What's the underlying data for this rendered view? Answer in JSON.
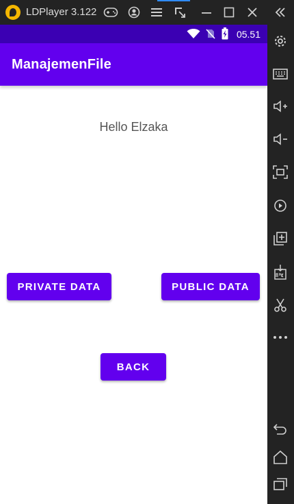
{
  "emulator": {
    "title": "LDPlayer 3.122",
    "titlebar_icons": [
      "gamepad-icon",
      "account-icon",
      "menu-icon",
      "sync-icon",
      "minimize-icon",
      "maximize-icon",
      "close-icon"
    ],
    "collapse_icon": "double-chevron-left-icon",
    "sidebar_icons": [
      "settings-icon",
      "keyboard-icon",
      "volume-up-icon",
      "volume-down-icon",
      "screenshot-icon",
      "record-icon",
      "add-window-icon",
      "install-apk-icon",
      "scissors-icon",
      "more-icon",
      "back-icon",
      "home-icon",
      "recents-icon"
    ],
    "accent_color": "#2f8cff"
  },
  "device": {
    "status_bar": {
      "time": "05.51",
      "icons": [
        "wifi-icon",
        "no-sim-icon",
        "battery-charging-icon"
      ],
      "color": "#3b00b3"
    },
    "app_bar": {
      "title": "ManajemenFile",
      "color": "#6200ee"
    },
    "content": {
      "greeting": "Hello Elzaka",
      "private_button": "PRIVATE DATA",
      "public_button": "PUBLIC DATA",
      "back_button": "BACK",
      "button_color": "#6200ee"
    }
  }
}
